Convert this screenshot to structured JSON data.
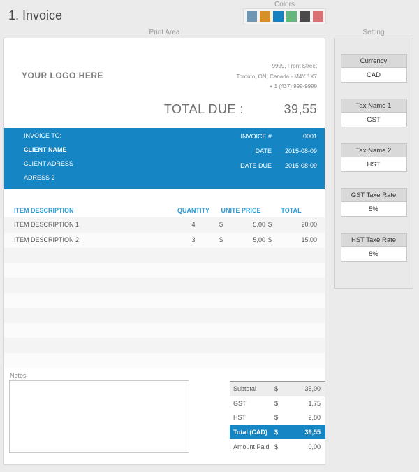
{
  "page": {
    "title": "1. Invoice",
    "print_area_label": "Print Area",
    "setting_label": "Setting"
  },
  "colors": {
    "label": "Colors",
    "swatches": [
      {
        "name": "steel-blue",
        "hex": "#6d96b4"
      },
      {
        "name": "orange",
        "hex": "#d69029"
      },
      {
        "name": "blue",
        "hex": "#1780be"
      },
      {
        "name": "green",
        "hex": "#63b67e"
      },
      {
        "name": "dark-gray",
        "hex": "#4a4a4a"
      },
      {
        "name": "salmon",
        "hex": "#d97373"
      }
    ]
  },
  "invoice": {
    "logo_placeholder": "YOUR LOGO HERE",
    "company_address": {
      "line1": "9999, Front Street",
      "line2": "Toronto, ON, Canada - M4Y 1X7",
      "line3": "+ 1 (437) 999-9999"
    },
    "total_due_label": "TOTAL DUE :",
    "total_due_value": "39,55",
    "bill_to": {
      "label": "INVOICE TO:",
      "client_name": "CLIENT NAME",
      "client_address": "CLIENT ADRESS",
      "address2": "ADRESS 2"
    },
    "meta": [
      {
        "label": "INVOICE #",
        "value": "0001"
      },
      {
        "label": "DATE",
        "value": "2015-08-09"
      },
      {
        "label": "DATE DUE",
        "value": "2015-08-09"
      }
    ],
    "items_table": {
      "headers": {
        "description": "ITEM DESCRIPTION",
        "quantity": "QUANTITY",
        "unit_price": "UNITE PRICE",
        "total": "TOTAL"
      },
      "currency_symbol": "$",
      "rows": [
        {
          "description": "ITEM DESCRIPTION 1",
          "quantity": "4",
          "unit_price": "5,00",
          "total": "20,00"
        },
        {
          "description": "ITEM DESCRIPTION 2",
          "quantity": "3",
          "unit_price": "5,00",
          "total": "15,00"
        }
      ],
      "empty_row_count": 8
    },
    "notes_label": "Notes",
    "summary": [
      {
        "label": "Subtotal",
        "symbol": "$",
        "value": "35,00",
        "style": "subtotal"
      },
      {
        "label": "GST",
        "symbol": "$",
        "value": "1,75",
        "style": "normal"
      },
      {
        "label": "HST",
        "symbol": "$",
        "value": "2,80",
        "style": "normal"
      },
      {
        "label": "Total (CAD)",
        "symbol": "$",
        "value": "39,55",
        "style": "total"
      },
      {
        "label": "Amount Paid",
        "symbol": "$",
        "value": "0,00",
        "style": "normal"
      }
    ]
  },
  "settings": {
    "fields": [
      {
        "label": "Currency",
        "value": "CAD"
      },
      {
        "label": "Tax Name 1",
        "value": "GST"
      },
      {
        "label": "Tax Name 2",
        "value": "HST"
      },
      {
        "label": "GST Taxe Rate",
        "value": "5%"
      },
      {
        "label": "HST Taxe Rate",
        "value": "8%"
      }
    ]
  },
  "theme": {
    "accent_blue": "#1585c4",
    "page_background": "#ebebeb"
  }
}
